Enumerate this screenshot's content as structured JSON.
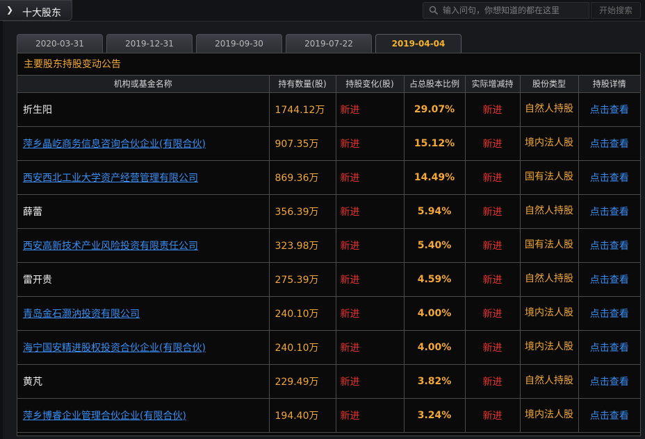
{
  "header": {
    "arrow_glyph": "❯",
    "title": "十大股东",
    "search_placeholder": "输入问句，你想知道的都在这里",
    "search_button": "开始搜索"
  },
  "tabs": [
    {
      "label": "2020-03-31",
      "active": false
    },
    {
      "label": "2019-12-31",
      "active": false
    },
    {
      "label": "2019-09-30",
      "active": false
    },
    {
      "label": "2019-07-22",
      "active": false
    },
    {
      "label": "2019-04-04",
      "active": true
    }
  ],
  "table": {
    "title": "主要股东持股变动公告",
    "headers": [
      "机构或基金名称",
      "持有数量(股)",
      "持股变化(股)",
      "占总股本比例",
      "实际增减持",
      "股份类型",
      "持股详情"
    ],
    "rows": [
      {
        "name": "折生阳",
        "is_link": false,
        "qty": "1744.12万",
        "change": "新进",
        "pct": "29.07%",
        "actual": "新进",
        "type": "自然人持股",
        "detail": "点击查看"
      },
      {
        "name": "萍乡晶屹商务信息咨询合伙企业(有限合伙)",
        "is_link": true,
        "qty": "907.35万",
        "change": "新进",
        "pct": "15.12%",
        "actual": "新进",
        "type": "境内法人股",
        "detail": "点击查看"
      },
      {
        "name": "西安西北工业大学资产经营管理有限公司",
        "is_link": true,
        "qty": "869.36万",
        "change": "新进",
        "pct": "14.49%",
        "actual": "新进",
        "type": "国有法人股",
        "detail": "点击查看"
      },
      {
        "name": "薛蕾",
        "is_link": false,
        "qty": "356.39万",
        "change": "新进",
        "pct": "5.94%",
        "actual": "新进",
        "type": "自然人持股",
        "detail": "点击查看"
      },
      {
        "name": "西安高新技术产业风险投资有限责任公司",
        "is_link": true,
        "qty": "323.98万",
        "change": "新进",
        "pct": "5.40%",
        "actual": "新进",
        "type": "国有法人股",
        "detail": "点击查看"
      },
      {
        "name": "雷开贵",
        "is_link": false,
        "qty": "275.39万",
        "change": "新进",
        "pct": "4.59%",
        "actual": "新进",
        "type": "自然人持股",
        "detail": "点击查看"
      },
      {
        "name": "青岛金石灏汭投资有限公司",
        "is_link": true,
        "qty": "240.10万",
        "change": "新进",
        "pct": "4.00%",
        "actual": "新进",
        "type": "境内法人股",
        "detail": "点击查看"
      },
      {
        "name": "海宁国安精进股权投资合伙企业(有限合伙)",
        "is_link": true,
        "qty": "240.10万",
        "change": "新进",
        "pct": "4.00%",
        "actual": "新进",
        "type": "境内法人股",
        "detail": "点击查看"
      },
      {
        "name": "黄芃",
        "is_link": false,
        "qty": "229.49万",
        "change": "新进",
        "pct": "3.82%",
        "actual": "新进",
        "type": "自然人持股",
        "detail": "点击查看"
      },
      {
        "name": "萍乡博睿企业管理合伙企业(有限合伙)",
        "is_link": true,
        "qty": "194.40万",
        "change": "新进",
        "pct": "3.24%",
        "actual": "新进",
        "type": "境内法人股",
        "detail": "点击查看"
      }
    ]
  }
}
